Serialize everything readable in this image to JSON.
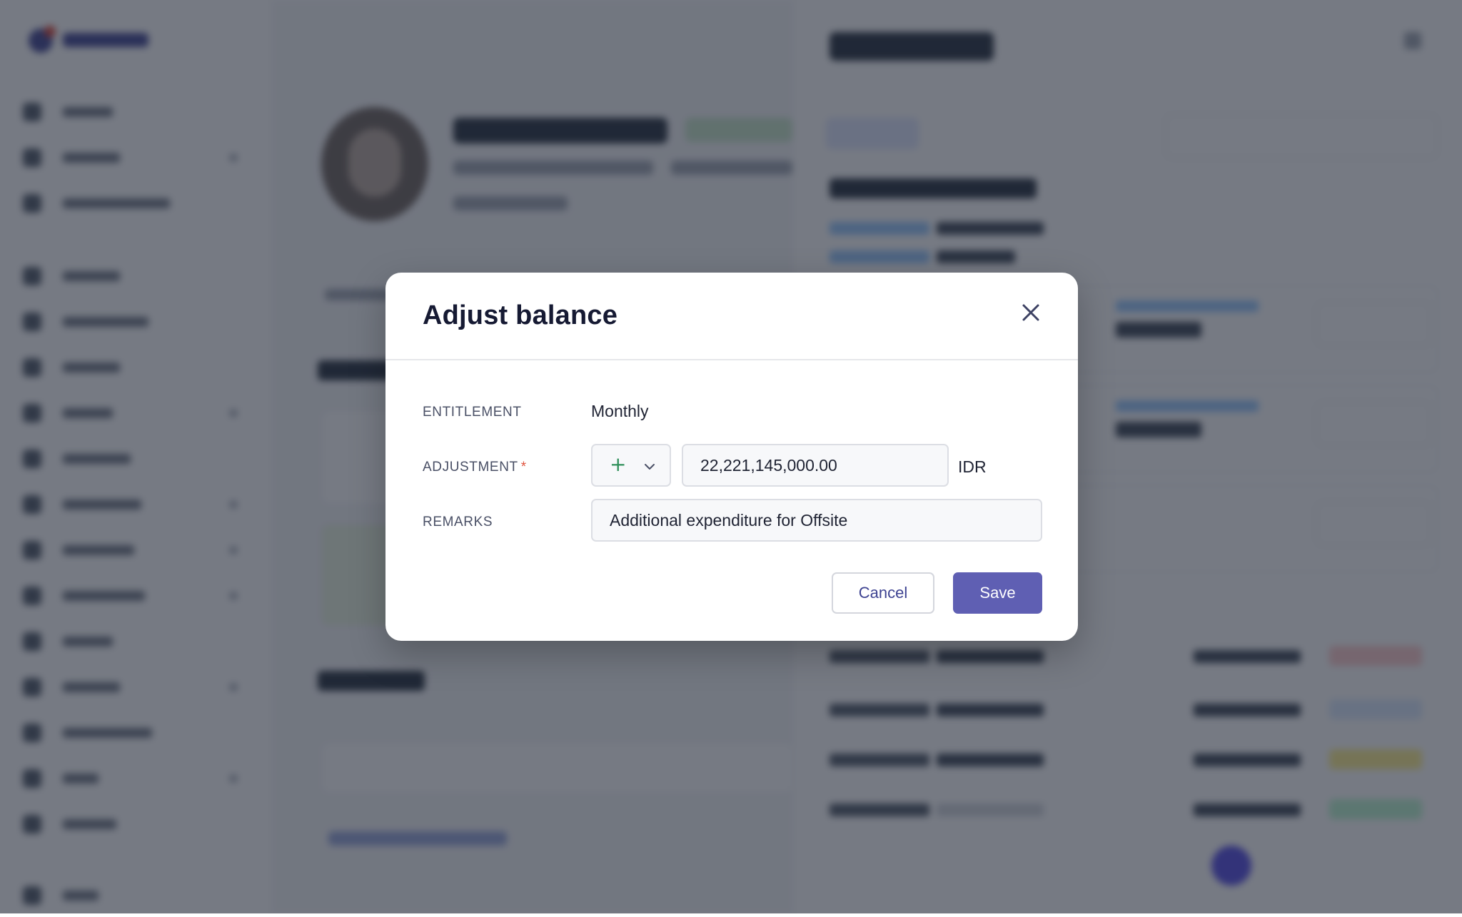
{
  "modal": {
    "title": "Adjust balance",
    "close_icon": "close-icon",
    "fields": {
      "entitlement": {
        "label": "ENTITLEMENT",
        "value": "Monthly"
      },
      "adjustment": {
        "label": "ADJUSTMENT",
        "required_marker": "*",
        "sign": "+",
        "sign_icon": "chevron-down-icon",
        "amount": "22,221,145,000.00",
        "currency": "IDR"
      },
      "remarks": {
        "label": "REMARKS",
        "value": "Additional expenditure for Offsite"
      }
    },
    "actions": {
      "cancel_label": "Cancel",
      "save_label": "Save"
    }
  },
  "colors": {
    "primary": "#5f5fb3",
    "plus_sign": "#2f8f59",
    "required": "#e0533d",
    "overlay": "rgba(34, 40, 55, 0.62)"
  }
}
